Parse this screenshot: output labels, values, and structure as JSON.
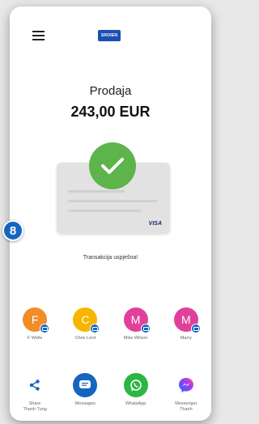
{
  "step_badge": "8",
  "header": {
    "logo_text": "SROIEN",
    "menu_icon": "hamburger-menu-icon"
  },
  "sale": {
    "title": "Prodaja",
    "amount": "243,00 EUR"
  },
  "card": {
    "brand": "VISA"
  },
  "status_message": "Transakcija uspješna!",
  "contacts": [
    {
      "initial": "F",
      "name": "F Wells",
      "color": "#f28c28"
    },
    {
      "initial": "C",
      "name": "Chris Lord",
      "color": "#f7b500"
    },
    {
      "initial": "M",
      "name": "Mike Wilson",
      "color": "#e0409b"
    },
    {
      "initial": "M",
      "name": "Marry",
      "color": "#e0409b"
    }
  ],
  "share_apps": [
    {
      "name": "Share",
      "sub": "Thanh Tung",
      "icon": "share-icon"
    },
    {
      "name": "Messages",
      "sub": "",
      "icon": "messages-icon"
    },
    {
      "name": "WhatsApp",
      "sub": "",
      "icon": "whatsapp-icon"
    },
    {
      "name": "Messenger",
      "sub": "Thanh",
      "icon": "messenger-icon"
    }
  ],
  "colors": {
    "accent": "#1565c0",
    "success": "#5db44a",
    "logo": "#1b4fb5"
  }
}
